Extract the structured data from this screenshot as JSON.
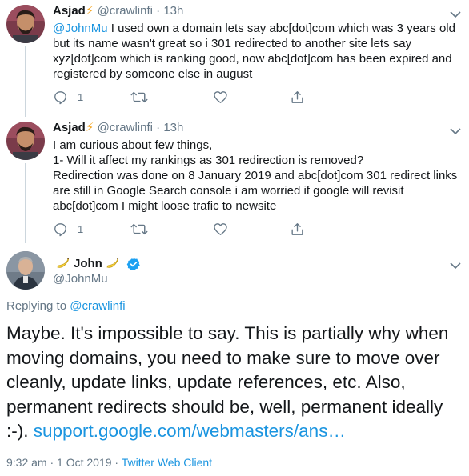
{
  "tweets": [
    {
      "name": "Asjad",
      "handle": "@crawlinfi",
      "separator": "·",
      "time": "13h",
      "mention": "@JohnMu",
      "text": " I used own a domain lets say abc[dot]com which was 3 years old but its name wasn't great so i 301 redirected to another site lets say xyz[dot]com which is ranking good,  now abc[dot]com has been expired and registered by someone else in august",
      "reply_count": "1"
    },
    {
      "name": "Asjad",
      "handle": "@crawlinfi",
      "separator": "·",
      "time": "13h",
      "text": "I am curious about few things,\n1- Will it affect my rankings as 301 redirection is removed?\nRedirection was done on 8 January 2019 and abc[dot]com 301 redirect links are still in Google Search console i am worried if google will revisit abc[dot]com I might loose trafic to newsite",
      "reply_count": "1"
    }
  ],
  "main_tweet": {
    "name": "John",
    "handle": "@JohnMu",
    "replying_prefix": "Replying to ",
    "replying_to": "@crawlinfi",
    "text": "Maybe. It's impossible to say. This is partially why when moving domains, you need to make sure to move over cleanly, update links, update references, etc. Also, permanent redirects should be, well, permanent ideally :-). ",
    "link": "support.google.com/webmasters/ans…",
    "timestamp": "9:32 am · 1 Oct 2019 · ",
    "client": "Twitter Web Client"
  },
  "colors": {
    "accent": "#1b95e0",
    "muted": "#657786",
    "text": "#14171a",
    "bolt": "#f5a623",
    "verified": "#1da1f2"
  },
  "icons": [
    "reply-icon",
    "retweet-icon",
    "like-icon",
    "share-icon",
    "chevron-down-icon",
    "verified-badge-icon",
    "banana-emoji-icon",
    "lightning-emoji-icon"
  ]
}
